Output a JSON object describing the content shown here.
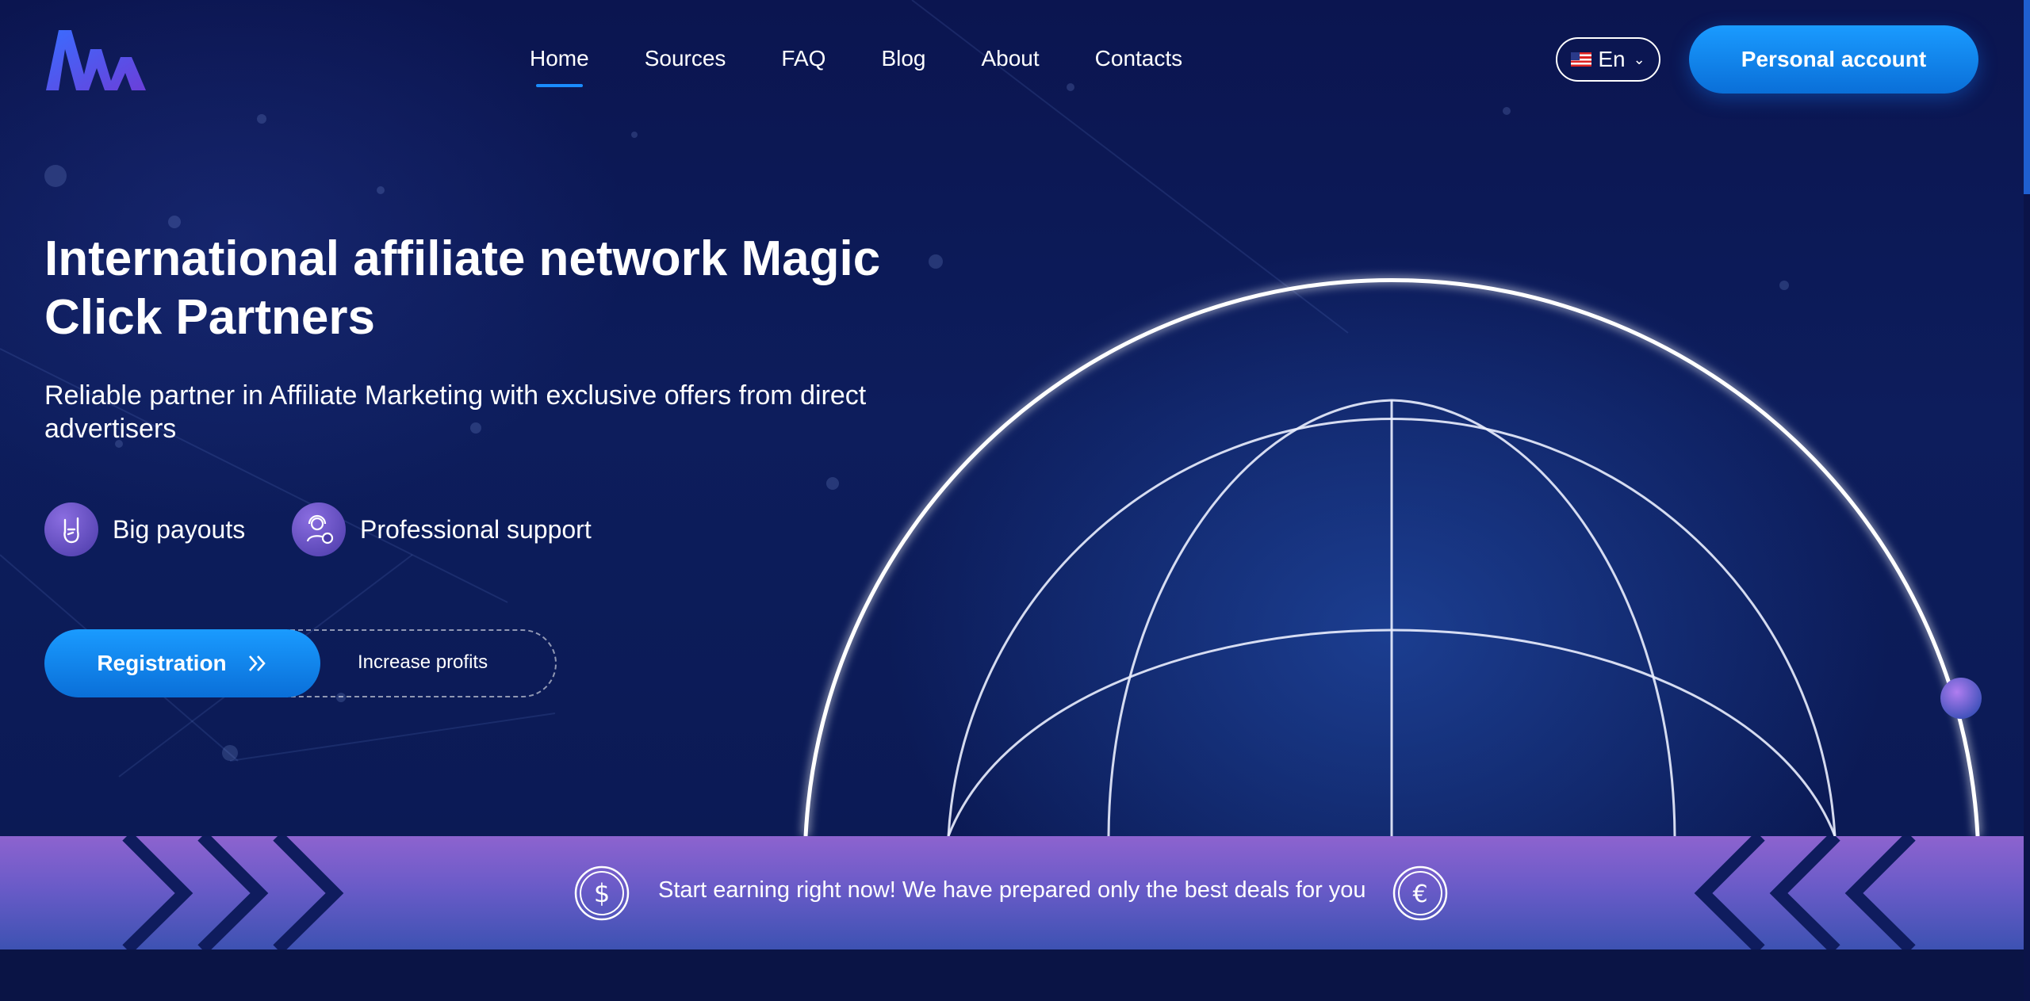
{
  "nav": {
    "items": [
      {
        "label": "Home",
        "active": true
      },
      {
        "label": "Sources",
        "active": false
      },
      {
        "label": "FAQ",
        "active": false
      },
      {
        "label": "Blog",
        "active": false
      },
      {
        "label": "About",
        "active": false
      },
      {
        "label": "Contacts",
        "active": false
      }
    ]
  },
  "header": {
    "language": "En",
    "account_label": "Personal account"
  },
  "hero": {
    "title": "International affiliate network Magic Click Partners",
    "subtitle": "Reliable partner in Affiliate Marketing with exclusive offers from direct advertisers",
    "features": [
      {
        "label": "Big payouts",
        "icon": "rock-hand-icon"
      },
      {
        "label": "Professional support",
        "icon": "support-agent-icon"
      }
    ],
    "register_label": "Registration",
    "secondary_label": "Increase profits"
  },
  "banner": {
    "text": "Start earning right now! We have prepared only the best deals for you",
    "left_icon": "dollar-coin-icon",
    "right_icon": "euro-coin-icon"
  },
  "colors": {
    "accent": "#1a8cff",
    "background": "#0b1550",
    "banner_top": "#8d63cf",
    "banner_bottom": "#3d52b2"
  }
}
